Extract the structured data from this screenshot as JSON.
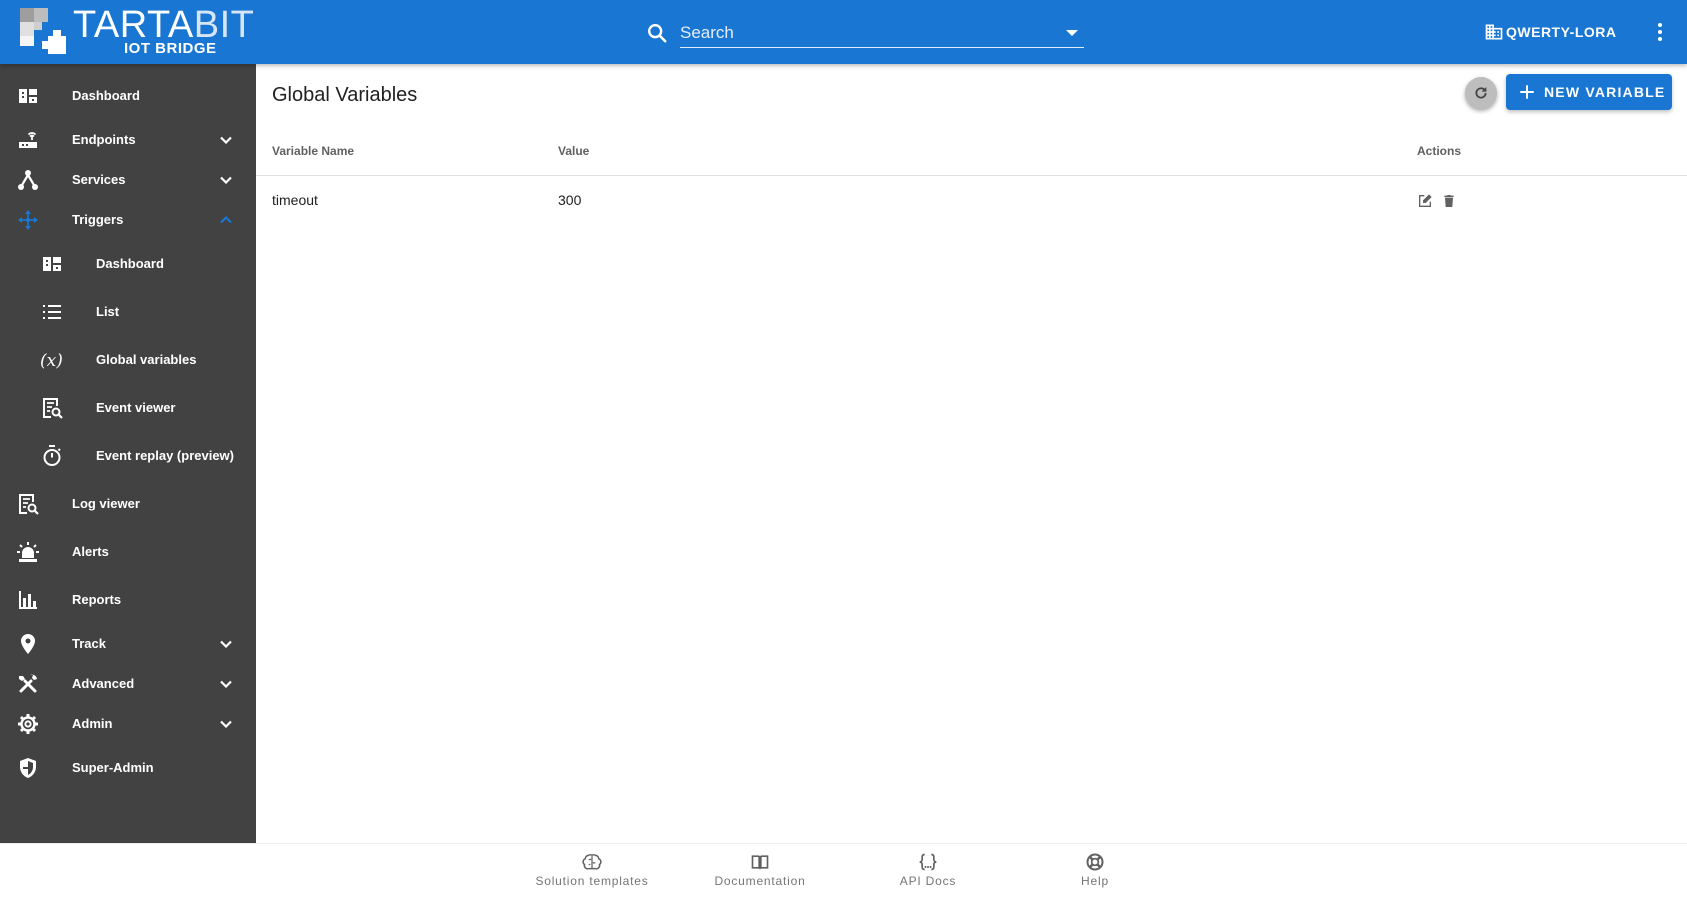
{
  "app": {
    "logo_primary": "TARTA",
    "logo_secondary": "BIT",
    "logo_sub": "IOT BRIDGE"
  },
  "search": {
    "placeholder": "Search"
  },
  "tenant": {
    "name": "QWERTY-LORA"
  },
  "sidebar": {
    "items": [
      {
        "label": "Dashboard",
        "icon": "dashboard-icon"
      },
      {
        "label": "Endpoints",
        "icon": "router-icon",
        "expandable": true
      },
      {
        "label": "Services",
        "icon": "services-hub-icon",
        "expandable": true
      },
      {
        "label": "Triggers",
        "icon": "triggers-icon",
        "expandable": true,
        "expanded": true
      },
      {
        "label": "Dashboard",
        "icon": "dashboard-icon",
        "sub": true
      },
      {
        "label": "List",
        "icon": "list-icon",
        "sub": true
      },
      {
        "label": "Global variables",
        "icon": "variable-icon",
        "sub": true,
        "selected": true
      },
      {
        "label": "Event viewer",
        "icon": "event-viewer-icon",
        "sub": true
      },
      {
        "label": "Event replay (preview)",
        "icon": "timer-icon",
        "sub": true
      },
      {
        "label": "Log viewer",
        "icon": "log-viewer-icon"
      },
      {
        "label": "Alerts",
        "icon": "alarm-light-icon"
      },
      {
        "label": "Reports",
        "icon": "bar-chart-icon"
      },
      {
        "label": "Track",
        "icon": "map-pin-icon",
        "expandable": true
      },
      {
        "label": "Advanced",
        "icon": "tools-icon",
        "expandable": true
      },
      {
        "label": "Admin",
        "icon": "gear-icon",
        "expandable": true
      },
      {
        "label": "Super-Admin",
        "icon": "shield-icon"
      }
    ]
  },
  "main": {
    "title": "Global Variables",
    "new_button_label": "NEW VARIABLE",
    "table": {
      "headers": {
        "name": "Variable Name",
        "value": "Value",
        "actions": "Actions"
      },
      "rows": [
        {
          "name": "timeout",
          "value": "300"
        }
      ]
    }
  },
  "footer": {
    "items": [
      {
        "label": "Solution templates",
        "icon": "brain-icon"
      },
      {
        "label": "Documentation",
        "icon": "book-icon"
      },
      {
        "label": "API Docs",
        "icon": "code-braces-icon"
      },
      {
        "label": "Help",
        "icon": "lifebuoy-icon"
      }
    ]
  },
  "colors": {
    "primary": "#1976d2",
    "sidebar_bg": "#424242",
    "active_accent": "#1976d2"
  }
}
